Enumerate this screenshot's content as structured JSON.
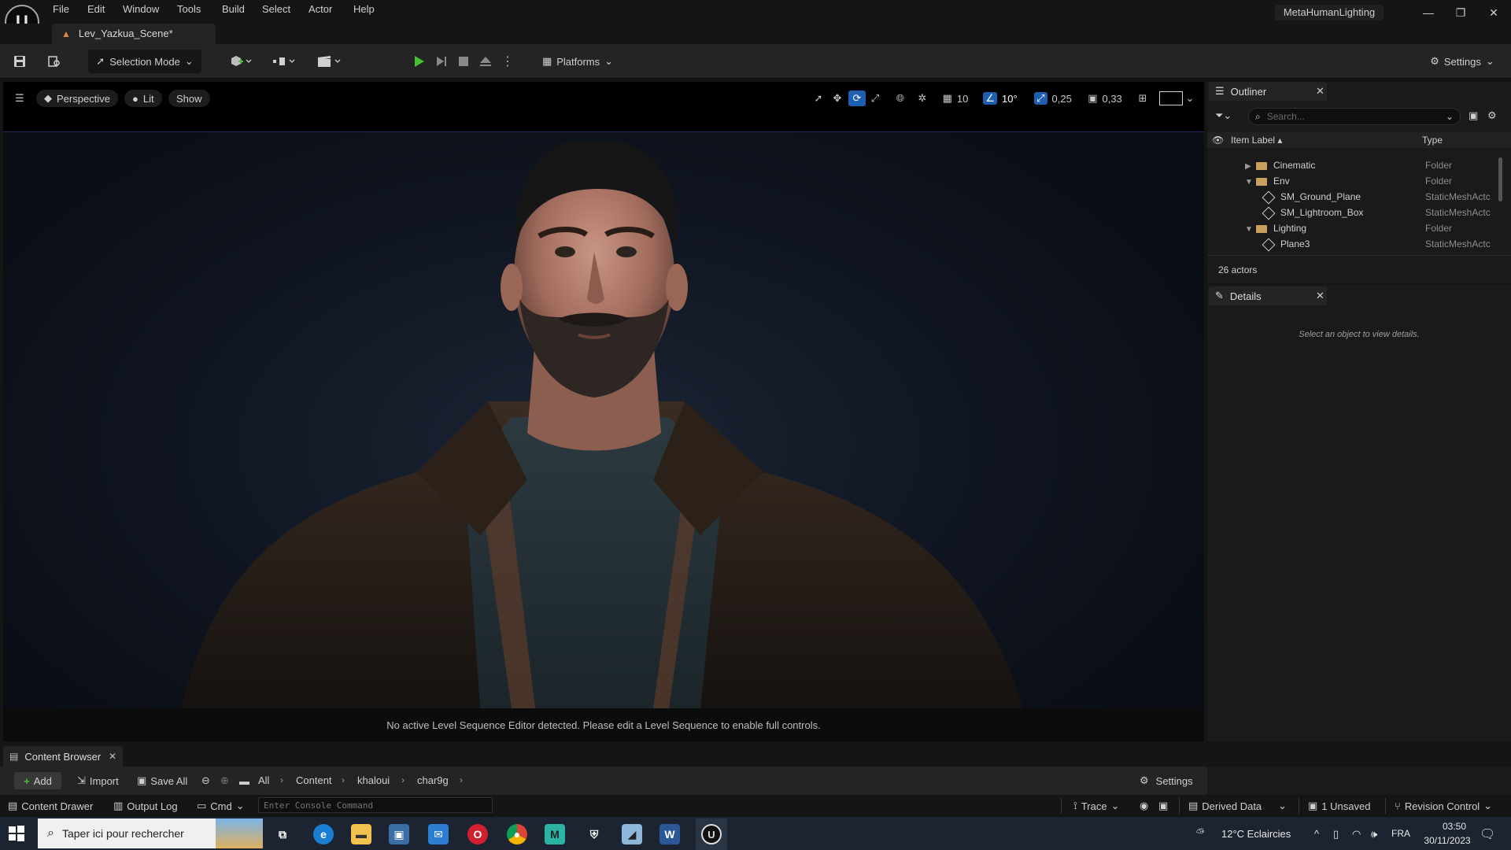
{
  "app": {
    "title": "MetaHumanLighting",
    "menu": [
      "File",
      "Edit",
      "Window",
      "Tools",
      "Build",
      "Select",
      "Actor",
      "Help"
    ],
    "level_tab": "Lev_Yazkua_Scene*"
  },
  "toolbar": {
    "selection_mode": "Selection Mode",
    "platforms": "Platforms",
    "settings": "Settings"
  },
  "viewport": {
    "perspective": "Perspective",
    "lit": "Lit",
    "show": "Show",
    "grid_snap": "10",
    "rotation_snap": "10°",
    "scale_snap": "0,25",
    "camera_speed": "0,33",
    "message": "No active Level Sequence Editor detected. Please edit a Level Sequence to enable full controls."
  },
  "outliner": {
    "title": "Outliner",
    "search_placeholder": "Search...",
    "col_label": "Item Label",
    "col_type": "Type",
    "rows": [
      {
        "label": "Cinematic",
        "type": "Folder",
        "kind": "folder",
        "expanded": false
      },
      {
        "label": "Env",
        "type": "Folder",
        "kind": "folder",
        "expanded": true
      },
      {
        "label": "SM_Ground_Plane",
        "type": "StaticMeshActc",
        "kind": "mesh"
      },
      {
        "label": "SM_Lightroom_Box",
        "type": "StaticMeshActc",
        "kind": "mesh"
      },
      {
        "label": "Lighting",
        "type": "Folder",
        "kind": "folder",
        "expanded": true
      },
      {
        "label": "Plane3",
        "type": "StaticMeshActc",
        "kind": "mesh"
      }
    ],
    "actors_count": "26 actors"
  },
  "details": {
    "title": "Details",
    "empty_message": "Select an object to view details."
  },
  "content_browser": {
    "title": "Content Browser",
    "add": "Add",
    "import": "Import",
    "save_all": "Save All",
    "settings": "Settings",
    "path": [
      "All",
      "Content",
      "khaloui",
      "char9g"
    ]
  },
  "statusbar": {
    "content_drawer": "Content Drawer",
    "output_log": "Output Log",
    "cmd": "Cmd",
    "console_placeholder": "Enter Console Command",
    "trace": "Trace",
    "derived_data": "Derived Data",
    "unsaved": "1 Unsaved",
    "revision_control": "Revision Control"
  },
  "taskbar": {
    "search_placeholder": "Taper ici pour rechercher",
    "weather": "12°C  Eclaircies",
    "language": "FRA",
    "time": "03:50",
    "date": "30/11/2023"
  },
  "colors": {
    "accent": "#1f5fb0",
    "play_green": "#46c232",
    "folder": "#c8a060"
  }
}
